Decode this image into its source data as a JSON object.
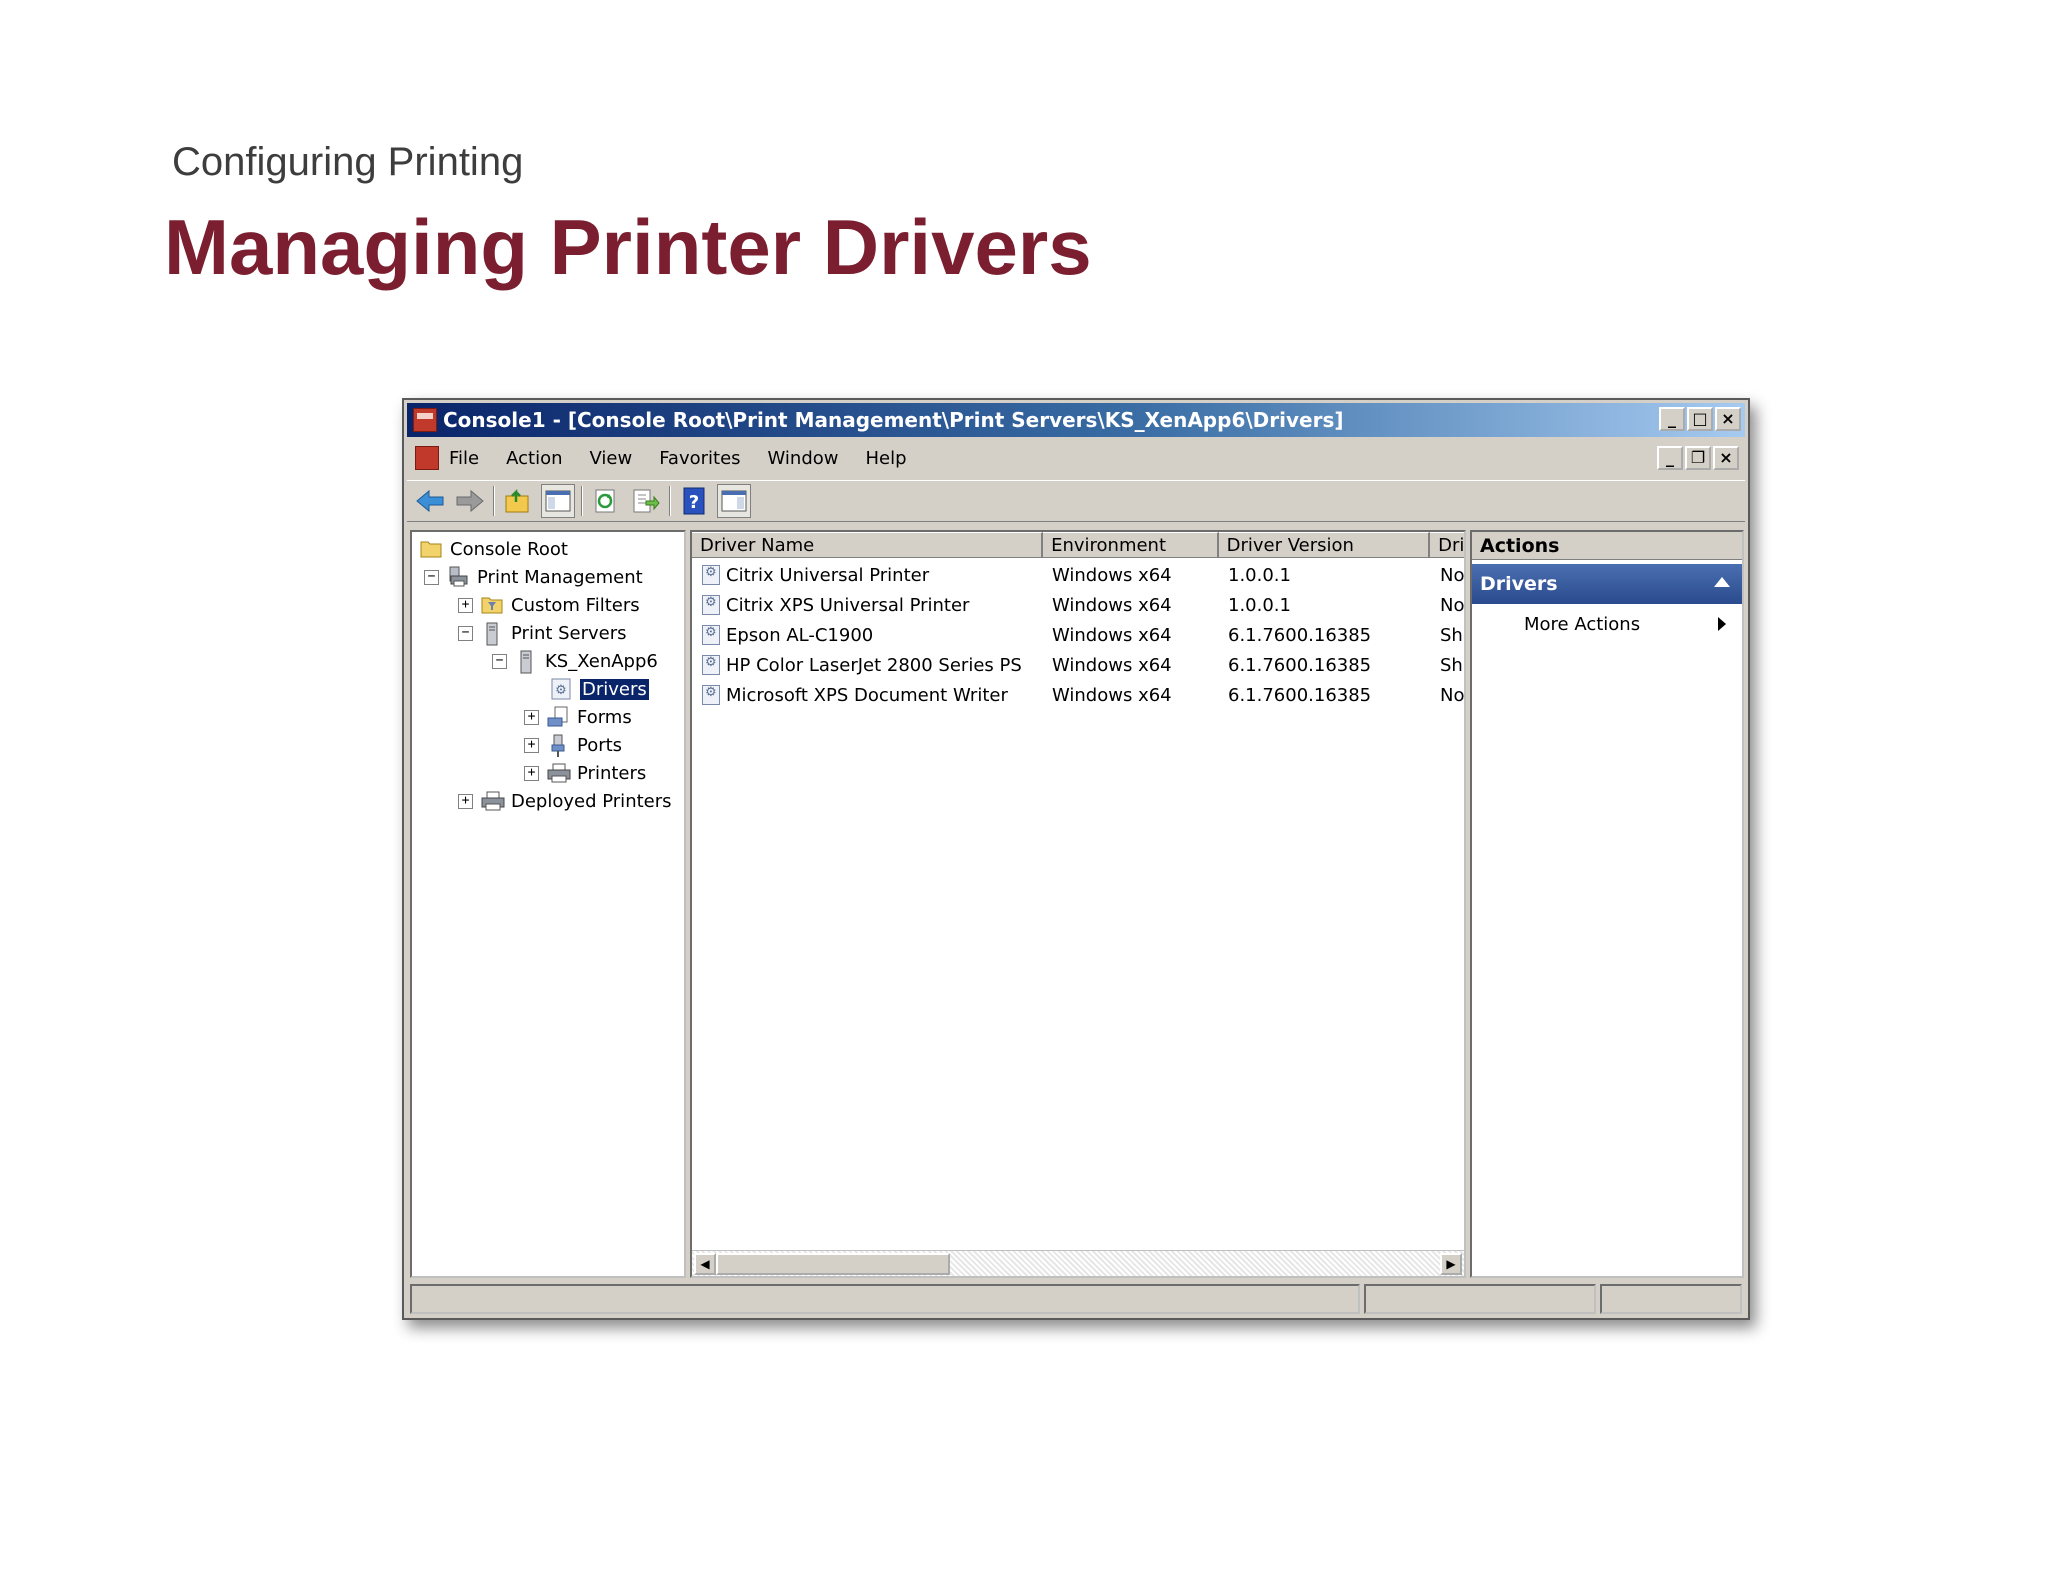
{
  "slide": {
    "subtitle": "Configuring Printing",
    "title": "Managing Printer Drivers"
  },
  "window": {
    "title": "Console1 - [Console Root\\Print Management\\Print Servers\\KS_XenApp6\\Drivers]",
    "controls": {
      "minimize": "_",
      "maximize": "□",
      "close": "×",
      "restore": "❐"
    }
  },
  "menu": [
    "File",
    "Action",
    "View",
    "Favorites",
    "Window",
    "Help"
  ],
  "toolbar": [
    "back-icon",
    "forward-icon",
    "up-folder-icon",
    "show-hide-tree-icon",
    "refresh-icon",
    "export-list-icon",
    "help-icon",
    "show-hide-action-pane-icon"
  ],
  "tree": {
    "console_root": "Console Root",
    "print_management": "Print Management",
    "custom_filters": "Custom Filters",
    "print_servers": "Print Servers",
    "server": "KS_XenApp6",
    "drivers": "Drivers",
    "forms": "Forms",
    "ports": "Ports",
    "printers": "Printers",
    "deployed_printers": "Deployed Printers",
    "expand": "+",
    "collapse": "−"
  },
  "list": {
    "columns": [
      "Driver Name",
      "Environment",
      "Driver Version",
      "Dri"
    ],
    "rows": [
      [
        "Citrix Universal Printer",
        "Windows x64",
        "1.0.0.1",
        "No"
      ],
      [
        "Citrix XPS Universal Printer",
        "Windows x64",
        "1.0.0.1",
        "No"
      ],
      [
        "Epson AL-C1900",
        "Windows x64",
        "6.1.7600.16385",
        "Sh"
      ],
      [
        "HP Color LaserJet 2800 Series PS",
        "Windows x64",
        "6.1.7600.16385",
        "Sh"
      ],
      [
        "Microsoft XPS Document Writer",
        "Windows x64",
        "6.1.7600.16385",
        "No"
      ]
    ],
    "scroll_left": "◀",
    "scroll_right": "▶"
  },
  "actions": {
    "title": "Actions",
    "section": "Drivers",
    "item": "More Actions"
  },
  "status": [
    "",
    "",
    ""
  ],
  "colors": {
    "title_accent": "#7b1f30",
    "titlebar_start": "#0a246a",
    "titlebar_end": "#a6caf0",
    "selection": "#0a246a"
  }
}
